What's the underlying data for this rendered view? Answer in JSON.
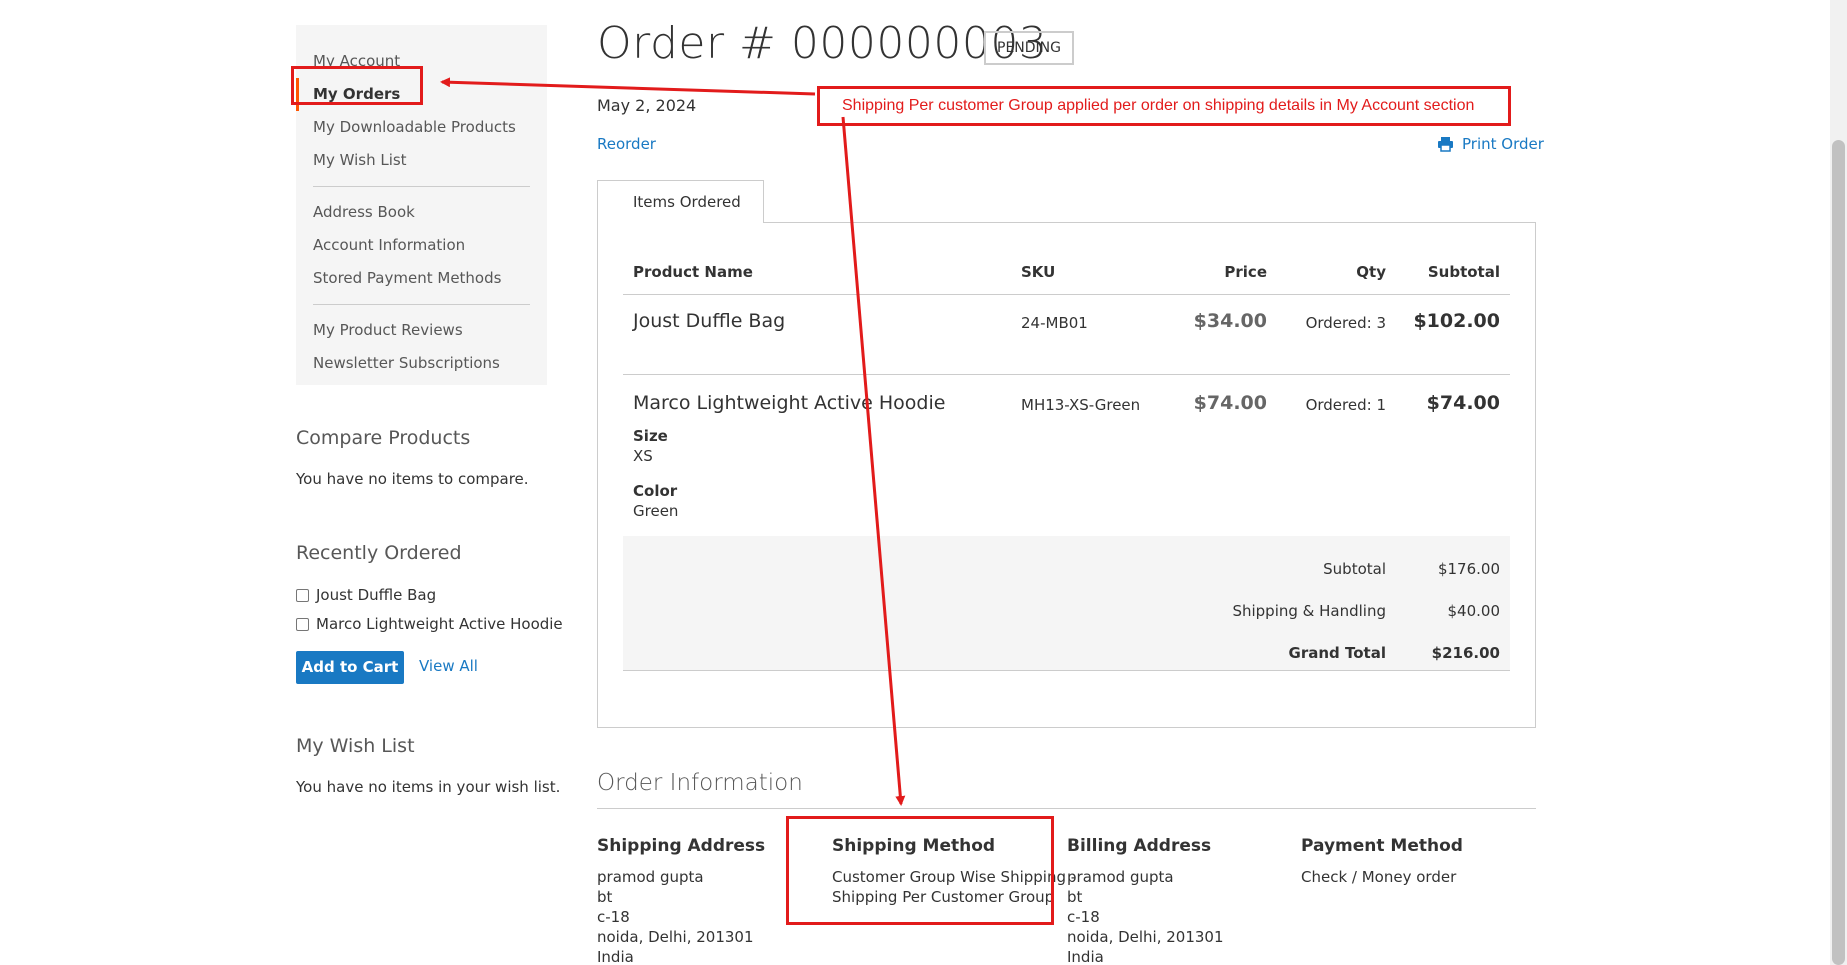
{
  "sidebar": {
    "nav_group1": [
      "My Account",
      "My Orders",
      "My Downloadable Products",
      "My Wish List"
    ],
    "nav_group2": [
      "Address Book",
      "Account Information",
      "Stored Payment Methods"
    ],
    "nav_group3": [
      "My Product Reviews",
      "Newsletter Subscriptions"
    ],
    "compare": {
      "title": "Compare Products",
      "empty": "You have no items to compare."
    },
    "recent": {
      "title": "Recently Ordered",
      "items": [
        "Joust Duffle Bag",
        "Marco Lightweight Active Hoodie"
      ],
      "add_to_cart": "Add to Cart",
      "view_all": "View All"
    },
    "wishlist": {
      "title": "My Wish List",
      "empty": "You have no items in your wish list."
    }
  },
  "order": {
    "title": "Order # 000000003",
    "status": "PENDING",
    "date": "May 2, 2024",
    "reorder": "Reorder",
    "print": "Print Order",
    "tab": "Items Ordered",
    "columns": [
      "Product Name",
      "SKU",
      "Price",
      "Qty",
      "Subtotal"
    ],
    "items": [
      {
        "name": "Joust Duffle Bag",
        "sku": "24-MB01",
        "price": "$34.00",
        "qty": "Ordered: 3",
        "subtotal": "$102.00"
      },
      {
        "name": "Marco Lightweight Active Hoodie",
        "sku": "MH13-XS-Green",
        "price": "$74.00",
        "qty": "Ordered: 1",
        "subtotal": "$74.00",
        "options": [
          {
            "label": "Size",
            "value": "XS"
          },
          {
            "label": "Color",
            "value": "Green"
          }
        ]
      }
    ],
    "totals": [
      {
        "label": "Subtotal",
        "value": "$176.00"
      },
      {
        "label": "Shipping & Handling",
        "value": "$40.00"
      },
      {
        "label": "Grand Total",
        "value": "$216.00"
      }
    ]
  },
  "info": {
    "title": "Order Information",
    "shipping_address": {
      "title": "Shipping Address",
      "lines": [
        "pramod gupta",
        "bt",
        "c-18",
        "noida, Delhi, 201301",
        "India"
      ]
    },
    "shipping_method": {
      "title": "Shipping Method",
      "lines": [
        "Customer Group Wise Shipping -",
        "Shipping Per Customer Group"
      ]
    },
    "billing_address": {
      "title": "Billing Address",
      "lines": [
        "pramod gupta",
        "bt",
        "c-18",
        "noida, Delhi, 201301",
        "India"
      ]
    },
    "payment_method": {
      "title": "Payment Method",
      "lines": [
        "Check / Money order"
      ]
    }
  },
  "annotation": {
    "text": "Shipping Per customer Group applied per order on shipping details in My Account section",
    "color": "#e21b1b"
  },
  "colors": {
    "link": "#1979c3",
    "active_marker": "#ff5501"
  }
}
